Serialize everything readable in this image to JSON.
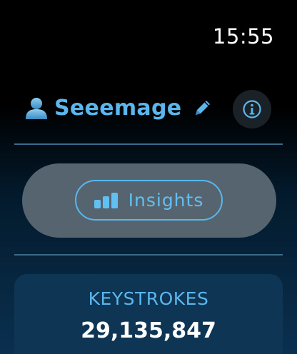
{
  "status_bar": {
    "time": "15:55"
  },
  "header": {
    "username": "Seeemage",
    "icons": {
      "user": "user-silhouette-icon",
      "edit": "pencil-icon",
      "info": "info-icon"
    }
  },
  "insights": {
    "label": "Insights",
    "icon": "bar-chart-icon"
  },
  "stats": {
    "label": "KEYSTROKES",
    "value": "29,135,847"
  },
  "colors": {
    "accent": "#5bb6ee",
    "panel": "#566470",
    "card": "#0f3554",
    "divider": "#3c6a8a"
  }
}
